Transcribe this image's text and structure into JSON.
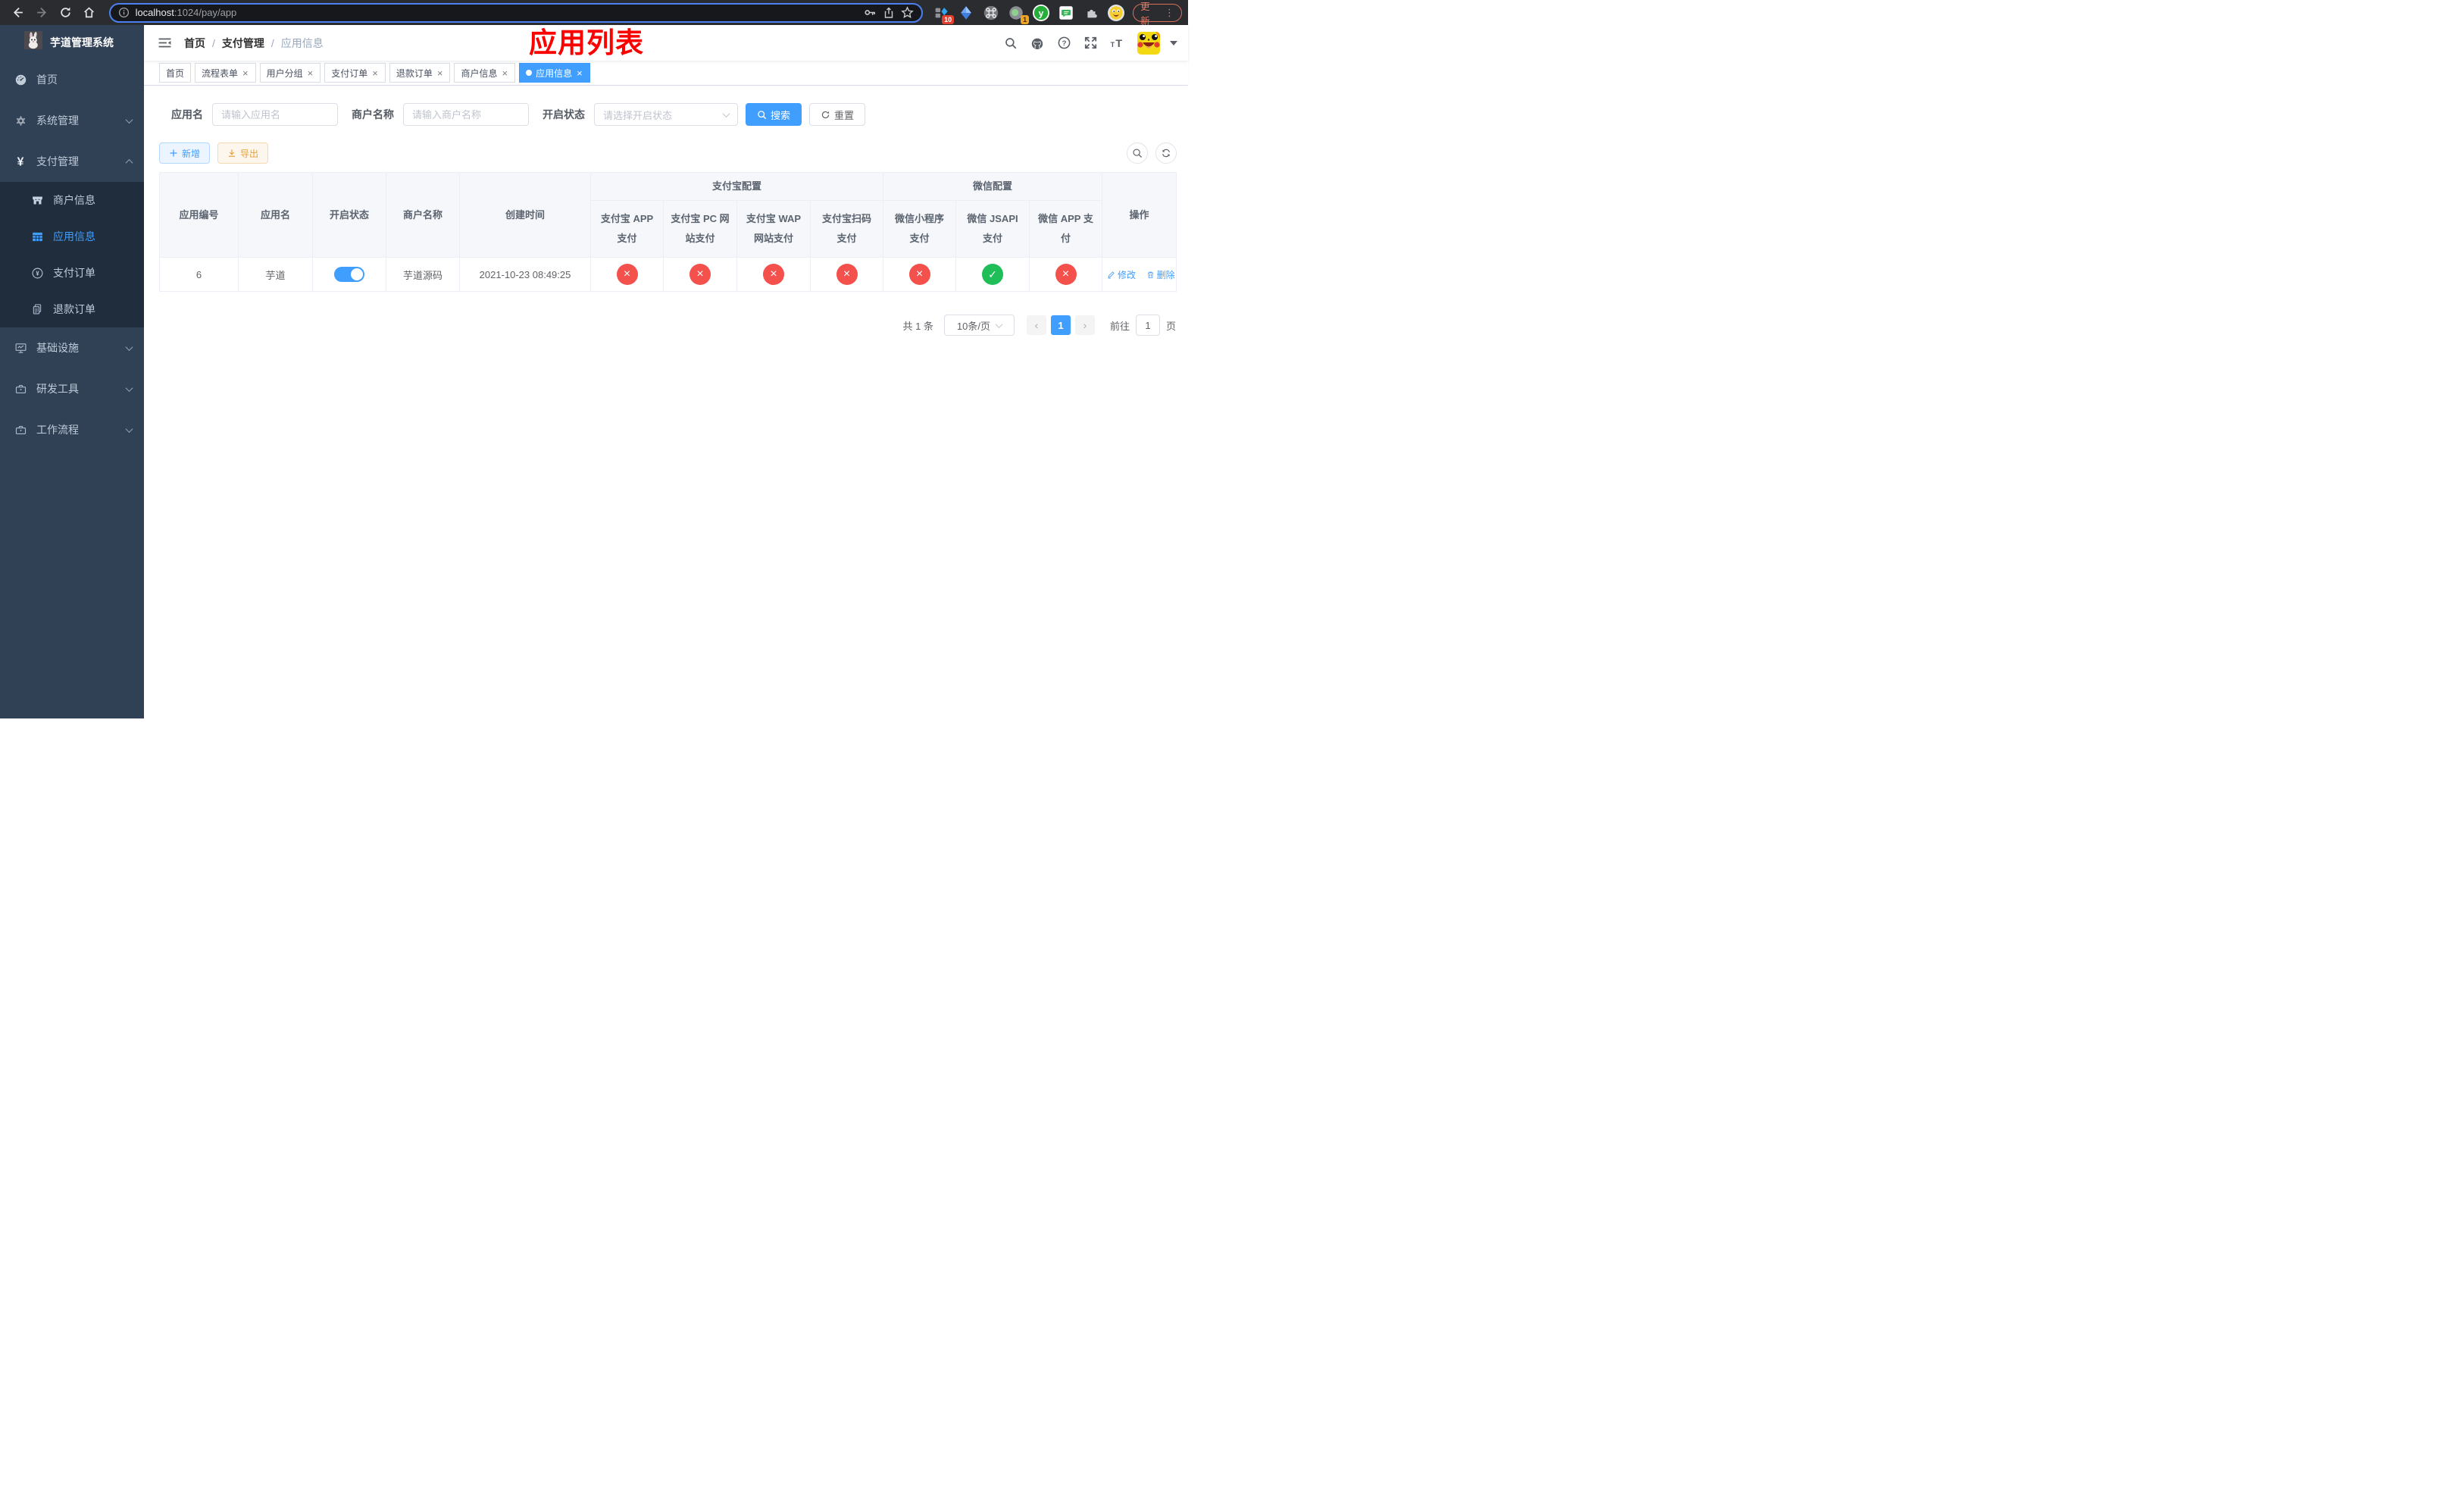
{
  "browser": {
    "url_host": "localhost",
    "url_path": ":1024/pay/app",
    "update_label": "更新",
    "ext_badge_red": "10",
    "ext_badge_orange": "1"
  },
  "sidebar": {
    "title": "芋道管理系统",
    "menu": [
      {
        "label": "首页"
      },
      {
        "label": "系统管理"
      },
      {
        "label": "支付管理"
      },
      {
        "label": "基础设施"
      },
      {
        "label": "研发工具"
      },
      {
        "label": "工作流程"
      }
    ],
    "submenu": [
      {
        "label": "商户信息"
      },
      {
        "label": "应用信息"
      },
      {
        "label": "支付订单"
      },
      {
        "label": "退款订单"
      }
    ]
  },
  "header": {
    "breadcrumb_home": "首页",
    "breadcrumb_parent": "支付管理",
    "breadcrumb_current": "应用信息",
    "annotation": "应用列表"
  },
  "tabs": [
    {
      "label": "首页"
    },
    {
      "label": "流程表单"
    },
    {
      "label": "用户分组"
    },
    {
      "label": "支付订单"
    },
    {
      "label": "退款订单"
    },
    {
      "label": "商户信息"
    },
    {
      "label": "应用信息"
    }
  ],
  "filters": {
    "app_name_label": "应用名",
    "app_name_placeholder": "请输入应用名",
    "merchant_label": "商户名称",
    "merchant_placeholder": "请输入商户名称",
    "status_label": "开启状态",
    "status_placeholder": "请选择开启状态",
    "search_label": "搜索",
    "reset_label": "重置"
  },
  "toolbar": {
    "add_label": "新增",
    "export_label": "导出"
  },
  "table": {
    "columns": {
      "app_id": "应用编号",
      "app_name": "应用名",
      "status": "开启状态",
      "merchant": "商户名称",
      "create_time": "创建时间",
      "group_alipay": "支付宝配置",
      "group_wechat": "微信配置",
      "alipay_app": "支付宝 APP 支付",
      "alipay_pc": "支付宝 PC 网站支付",
      "alipay_wap": "支付宝 WAP 网站支付",
      "alipay_scan": "支付宝扫码支付",
      "wechat_mini": "微信小程序支付",
      "wechat_jsapi": "微信 JSAPI 支付",
      "wechat_app": "微信 APP 支付",
      "actions": "操作"
    },
    "row": {
      "app_id": "6",
      "app_name": "芋道",
      "status": "on",
      "merchant": "芋道源码",
      "create_time": "2021-10-23 08:49:25",
      "alipay_app": "disabled",
      "alipay_pc": "disabled",
      "alipay_wap": "disabled",
      "alipay_scan": "disabled",
      "wechat_mini": "disabled",
      "wechat_jsapi": "enabled",
      "wechat_app": "disabled",
      "edit_label": "修改",
      "delete_label": "删除"
    }
  },
  "pagination": {
    "total_label": "共 1 条",
    "page_size_label": "10条/页",
    "current_page": "1",
    "goto_label": "前往",
    "goto_value": "1",
    "unit_label": "页"
  },
  "colors": {
    "accent_blue": "#409eff",
    "danger_red": "#f4504c",
    "success_green": "#1fbe59",
    "sidebar_bg": "#304156",
    "submenu_bg": "#1f2d3d"
  }
}
